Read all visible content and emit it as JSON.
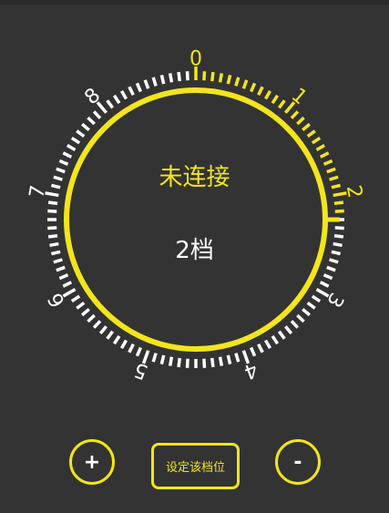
{
  "dial": {
    "gear_labels": [
      "0",
      "1",
      "2",
      "3",
      "4",
      "5",
      "6",
      "7",
      "8"
    ],
    "current_gear": 2,
    "gear_count": 9,
    "colors": {
      "accent": "#f3e51b",
      "tick": "#ffffff",
      "background": "#333333"
    }
  },
  "status": {
    "connection": "未连接"
  },
  "gear": {
    "display": "2档"
  },
  "controls": {
    "increase_label": "+",
    "decrease_label": "-",
    "set_label": "设定该档位"
  }
}
